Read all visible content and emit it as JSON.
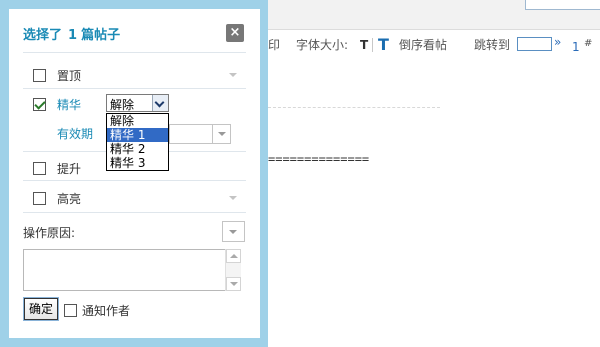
{
  "background": {
    "toolbar": {
      "print_label": "印",
      "font_size_label": "字体大小:",
      "font_small_icon": "T",
      "font_big_icon": "T",
      "reverse_view_label": "倒序看帖",
      "jump_label": "跳转到",
      "jump_value": "",
      "jump_go": "»",
      "page_number": "1",
      "page_suffix": "#"
    },
    "separator_text": "=============="
  },
  "dialog": {
    "title_prefix": "选择了",
    "count": "1",
    "title_suffix": "篇帖子",
    "close_icon": "×",
    "options": [
      {
        "label": "置顶",
        "checked": false
      },
      {
        "label": "精华",
        "checked": true
      },
      {
        "label": "提升",
        "checked": false
      },
      {
        "label": "高亮",
        "checked": false
      }
    ],
    "digest_select": {
      "value": "解除",
      "options": [
        "解除",
        "精华 1",
        "精华 2",
        "精华 3"
      ],
      "highlighted_index": 1
    },
    "expire_label": "有效期",
    "reason_label": "操作原因:",
    "reason_text": "",
    "confirm_label": "确定",
    "notify_label": "通知作者",
    "notify_checked": false
  },
  "colors": {
    "frame": "#9fd1e8",
    "title": "#1a8ab5",
    "selection": "#316ac5"
  }
}
